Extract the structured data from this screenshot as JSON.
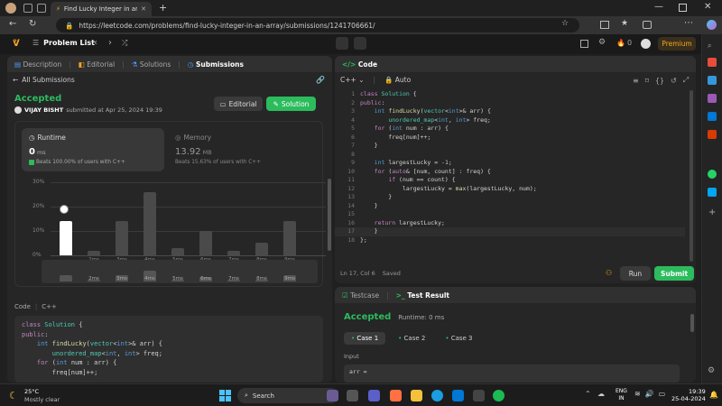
{
  "browser": {
    "tab_title": "Find Lucky Integer in an Array - L",
    "url": "https://leetcode.com/problems/find-lucky-integer-in-an-array/submissions/1241706661/"
  },
  "header": {
    "problem_list": "Problem List",
    "premium": "Premium",
    "streak": "0"
  },
  "left": {
    "tabs": [
      "Description",
      "Editorial",
      "Solutions",
      "Submissions"
    ],
    "all_submissions": "All Submissions",
    "status": "Accepted",
    "user": "VIJAY BISHT",
    "submitted": "submitted at Apr 25, 2024 19:39",
    "editorial_btn": "Editorial",
    "solution_btn": "Solution",
    "runtime_label": "Runtime",
    "runtime_value": "0",
    "runtime_unit": "ms",
    "runtime_beats": "Beats 100.00% of users with C++",
    "memory_label": "Memory",
    "memory_value": "13.92",
    "memory_unit": "MB",
    "memory_beats": "Beats 15.63% of users with C++",
    "code_label": "Code",
    "code_lang": "C++"
  },
  "chart_data": {
    "type": "bar",
    "yticks": [
      "30%",
      "20%",
      "10%",
      "0%"
    ],
    "ylim": [
      0,
      30
    ],
    "categories": [
      "",
      "2ms",
      "3ms",
      "4ms",
      "5ms",
      "6ms",
      "7ms",
      "8ms",
      "9ms"
    ],
    "values": [
      14,
      2,
      14,
      26,
      3,
      10,
      2,
      5,
      14
    ],
    "highlight_index": 0
  },
  "editor": {
    "title": "Code",
    "lang": "C++",
    "auto": "Auto",
    "status": "Ln 17, Col 6",
    "saved": "Saved",
    "run": "Run",
    "submit": "Submit",
    "lines": [
      "class Solution {",
      "public:",
      "    int findLucky(vector<int>& arr) {",
      "        unordered_map<int, int> freq;",
      "    for (int num : arr) {",
      "        freq[num]++;",
      "    }",
      "",
      "    int largestLucky = -1;",
      "    for (auto& [num, count] : freq) {",
      "        if (num == count) {",
      "            largestLucky = max(largestLucky, num);",
      "        }",
      "    }",
      "",
      "    return largestLucky;",
      "    }",
      "};"
    ]
  },
  "left_code": {
    "lines": [
      "class Solution {",
      "public:",
      "    int findLucky(vector<int>& arr) {",
      "        unordered_map<int, int> freq;",
      "    for (int num : arr) {",
      "        freq[num]++;"
    ]
  },
  "test": {
    "tab1": "Testcase",
    "tab2": "Test Result",
    "status": "Accepted",
    "runtime": "Runtime: 0 ms",
    "cases": [
      "Case 1",
      "Case 2",
      "Case 3"
    ],
    "input_label": "Input",
    "input_value": "arr ="
  },
  "taskbar": {
    "temp": "25°C",
    "weather": "Mostly clear",
    "search": "Search",
    "lang1": "ENG",
    "lang2": "IN",
    "time": "19:39",
    "date": "25-04-2024"
  }
}
